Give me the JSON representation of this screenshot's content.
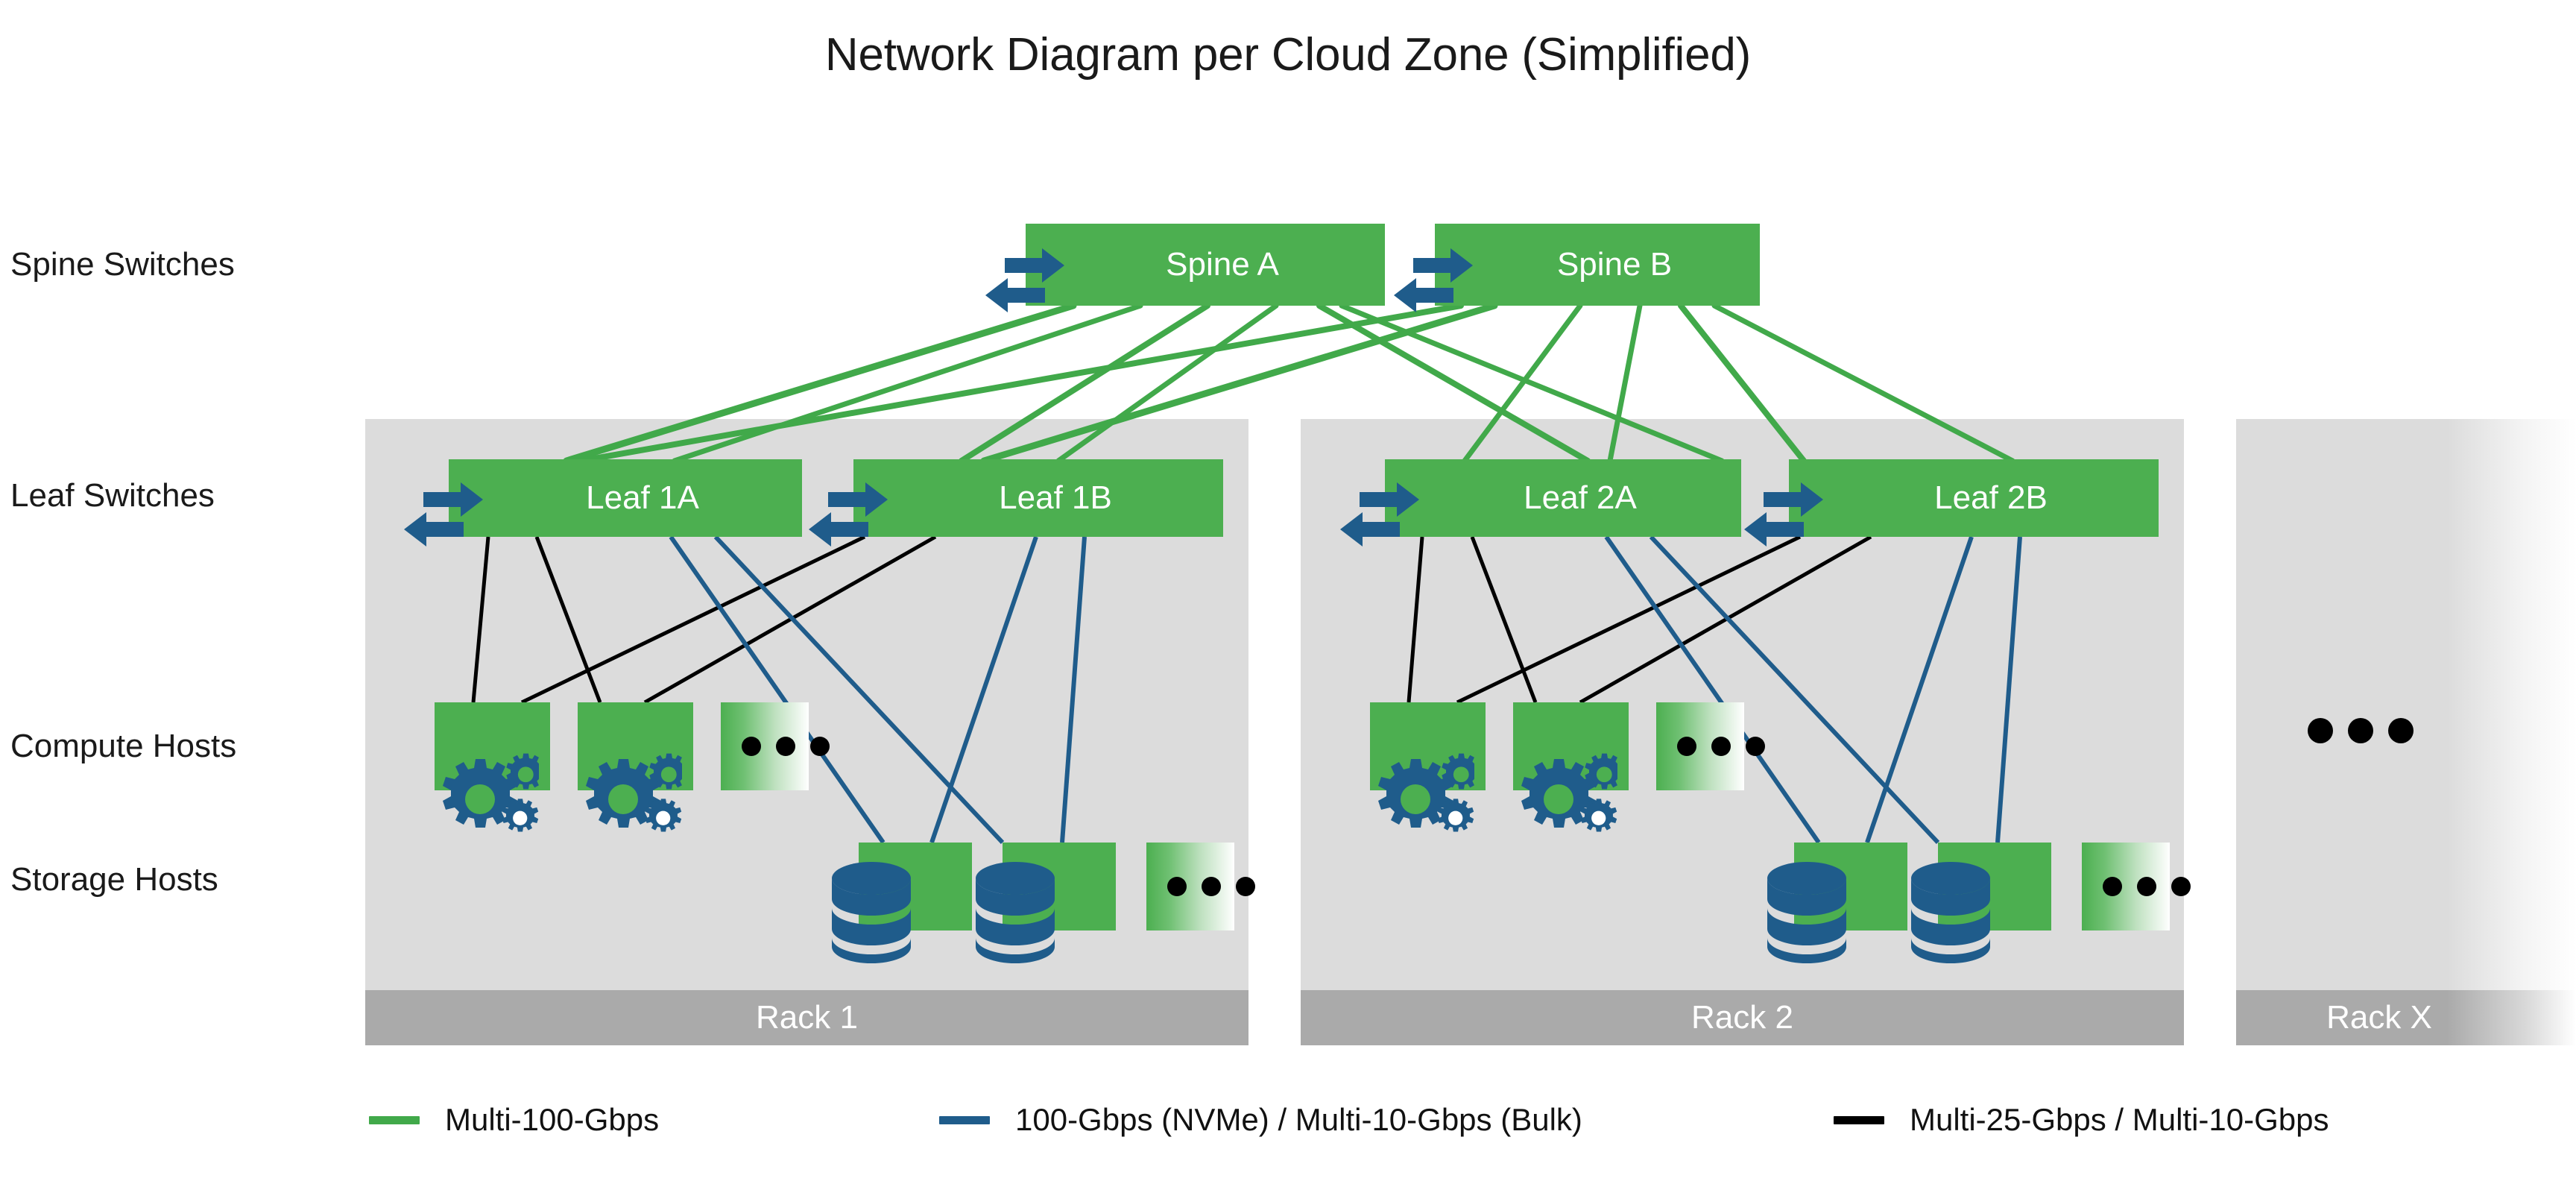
{
  "title": "Network Diagram per Cloud Zone (Simplified)",
  "row_labels": {
    "spine": "Spine Switches",
    "leaf": "Leaf Switches",
    "compute": "Compute Hosts",
    "storage": "Storage Hosts"
  },
  "colors": {
    "node_green": "#4CAF50",
    "icon_blue": "#1F5C8B",
    "rack_bg": "#dcdcdc",
    "rack_footer": "#aaaaaa",
    "link_green": "#41A94A",
    "link_blue": "#1F5C8B",
    "link_black": "#000000"
  },
  "spines": [
    {
      "label": "Spine A"
    },
    {
      "label": "Spine B"
    }
  ],
  "racks": [
    {
      "footer_label": "Rack 1",
      "leaves": [
        {
          "label": "Leaf 1A"
        },
        {
          "label": "Leaf 1B"
        }
      ],
      "compute_hosts": [
        {
          "icon": "gears-icon"
        },
        {
          "icon": "gears-icon"
        }
      ],
      "compute_more": "…",
      "storage_hosts": [
        {
          "icon": "database-icon"
        },
        {
          "icon": "database-icon"
        }
      ],
      "storage_more": "…"
    },
    {
      "footer_label": "Rack 2",
      "leaves": [
        {
          "label": "Leaf 2A"
        },
        {
          "label": "Leaf 2B"
        }
      ],
      "compute_hosts": [
        {
          "icon": "gears-icon"
        },
        {
          "icon": "gears-icon"
        }
      ],
      "compute_more": "…",
      "storage_hosts": [
        {
          "icon": "database-icon"
        },
        {
          "icon": "database-icon"
        }
      ],
      "storage_more": "…"
    },
    {
      "footer_label": "Rack X",
      "leaves": [],
      "compute_hosts": [],
      "compute_more": "…",
      "storage_hosts": [],
      "storage_more": "…"
    }
  ],
  "legend": [
    {
      "color": "#41A94A",
      "label": "Multi-100-Gbps"
    },
    {
      "color": "#1F5C8B",
      "label": "100-Gbps (NVMe) / Multi-10-Gbps (Bulk)"
    },
    {
      "color": "#000000",
      "label": "Multi-25-Gbps / Multi-10-Gbps"
    }
  ]
}
